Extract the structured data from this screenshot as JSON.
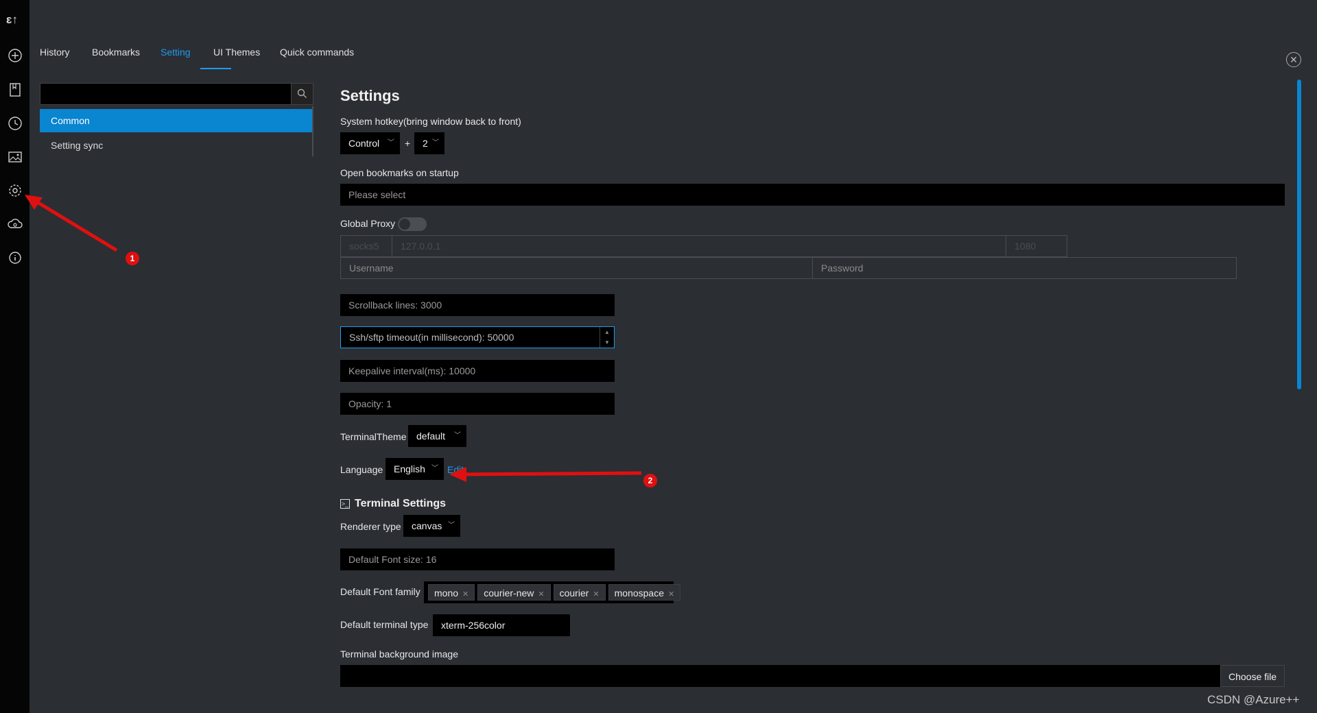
{
  "rail": {
    "logo": "ɛ↑",
    "icons": [
      "add-icon",
      "bookmark-icon",
      "history-icon",
      "image-icon",
      "settings-icon",
      "cloud-sync-icon",
      "info-icon"
    ]
  },
  "tabs": [
    {
      "label": "History"
    },
    {
      "label": "Bookmarks"
    },
    {
      "label": "Setting",
      "active": true
    },
    {
      "label": "UI Themes"
    },
    {
      "label": "Quick commands"
    }
  ],
  "sidebar": {
    "search_placeholder": "",
    "items": [
      {
        "label": "Common",
        "active": true
      },
      {
        "label": "Setting sync"
      }
    ]
  },
  "settings": {
    "title": "Settings",
    "hotkey_label": "System hotkey(bring window back to front)",
    "hotkey_modifier": "Control",
    "hotkey_plus": "+",
    "hotkey_key": "2",
    "bookmarks_label": "Open bookmarks on startup",
    "bookmarks_placeholder": "Please select",
    "global_proxy_label": "Global Proxy",
    "proxy_type": "socks5",
    "proxy_host": "127.0.0.1",
    "proxy_port": "1080",
    "username_placeholder": "Username",
    "password_placeholder": "Password",
    "scrollback": "Scrollback lines: 3000",
    "ssh_timeout": "Ssh/sftp timeout(in millisecond): 50000",
    "keepalive": "Keepalive interval(ms): 10000",
    "opacity": "Opacity: 1",
    "terminal_theme_label": "TerminalTheme",
    "terminal_theme_value": "default",
    "language_label": "Language",
    "language_value": "English",
    "edit_link": "Edit"
  },
  "terminal": {
    "section_title": "Terminal Settings",
    "renderer_label": "Renderer type",
    "renderer_value": "canvas",
    "font_size": "Default Font size: 16",
    "font_family_label": "Default Font family",
    "font_families": [
      "mono",
      "courier-new",
      "courier",
      "monospace"
    ],
    "terminal_type_label": "Default terminal type",
    "terminal_type_value": "xterm-256color",
    "bg_image_label": "Terminal background image",
    "choose_file": "Choose file"
  },
  "annotations": {
    "badge1": "1",
    "badge2": "2"
  },
  "watermark": "CSDN @Azure++",
  "colors": {
    "accent": "#1e9bf0",
    "active_item": "#0a85d0",
    "annotation": "#e01010"
  }
}
